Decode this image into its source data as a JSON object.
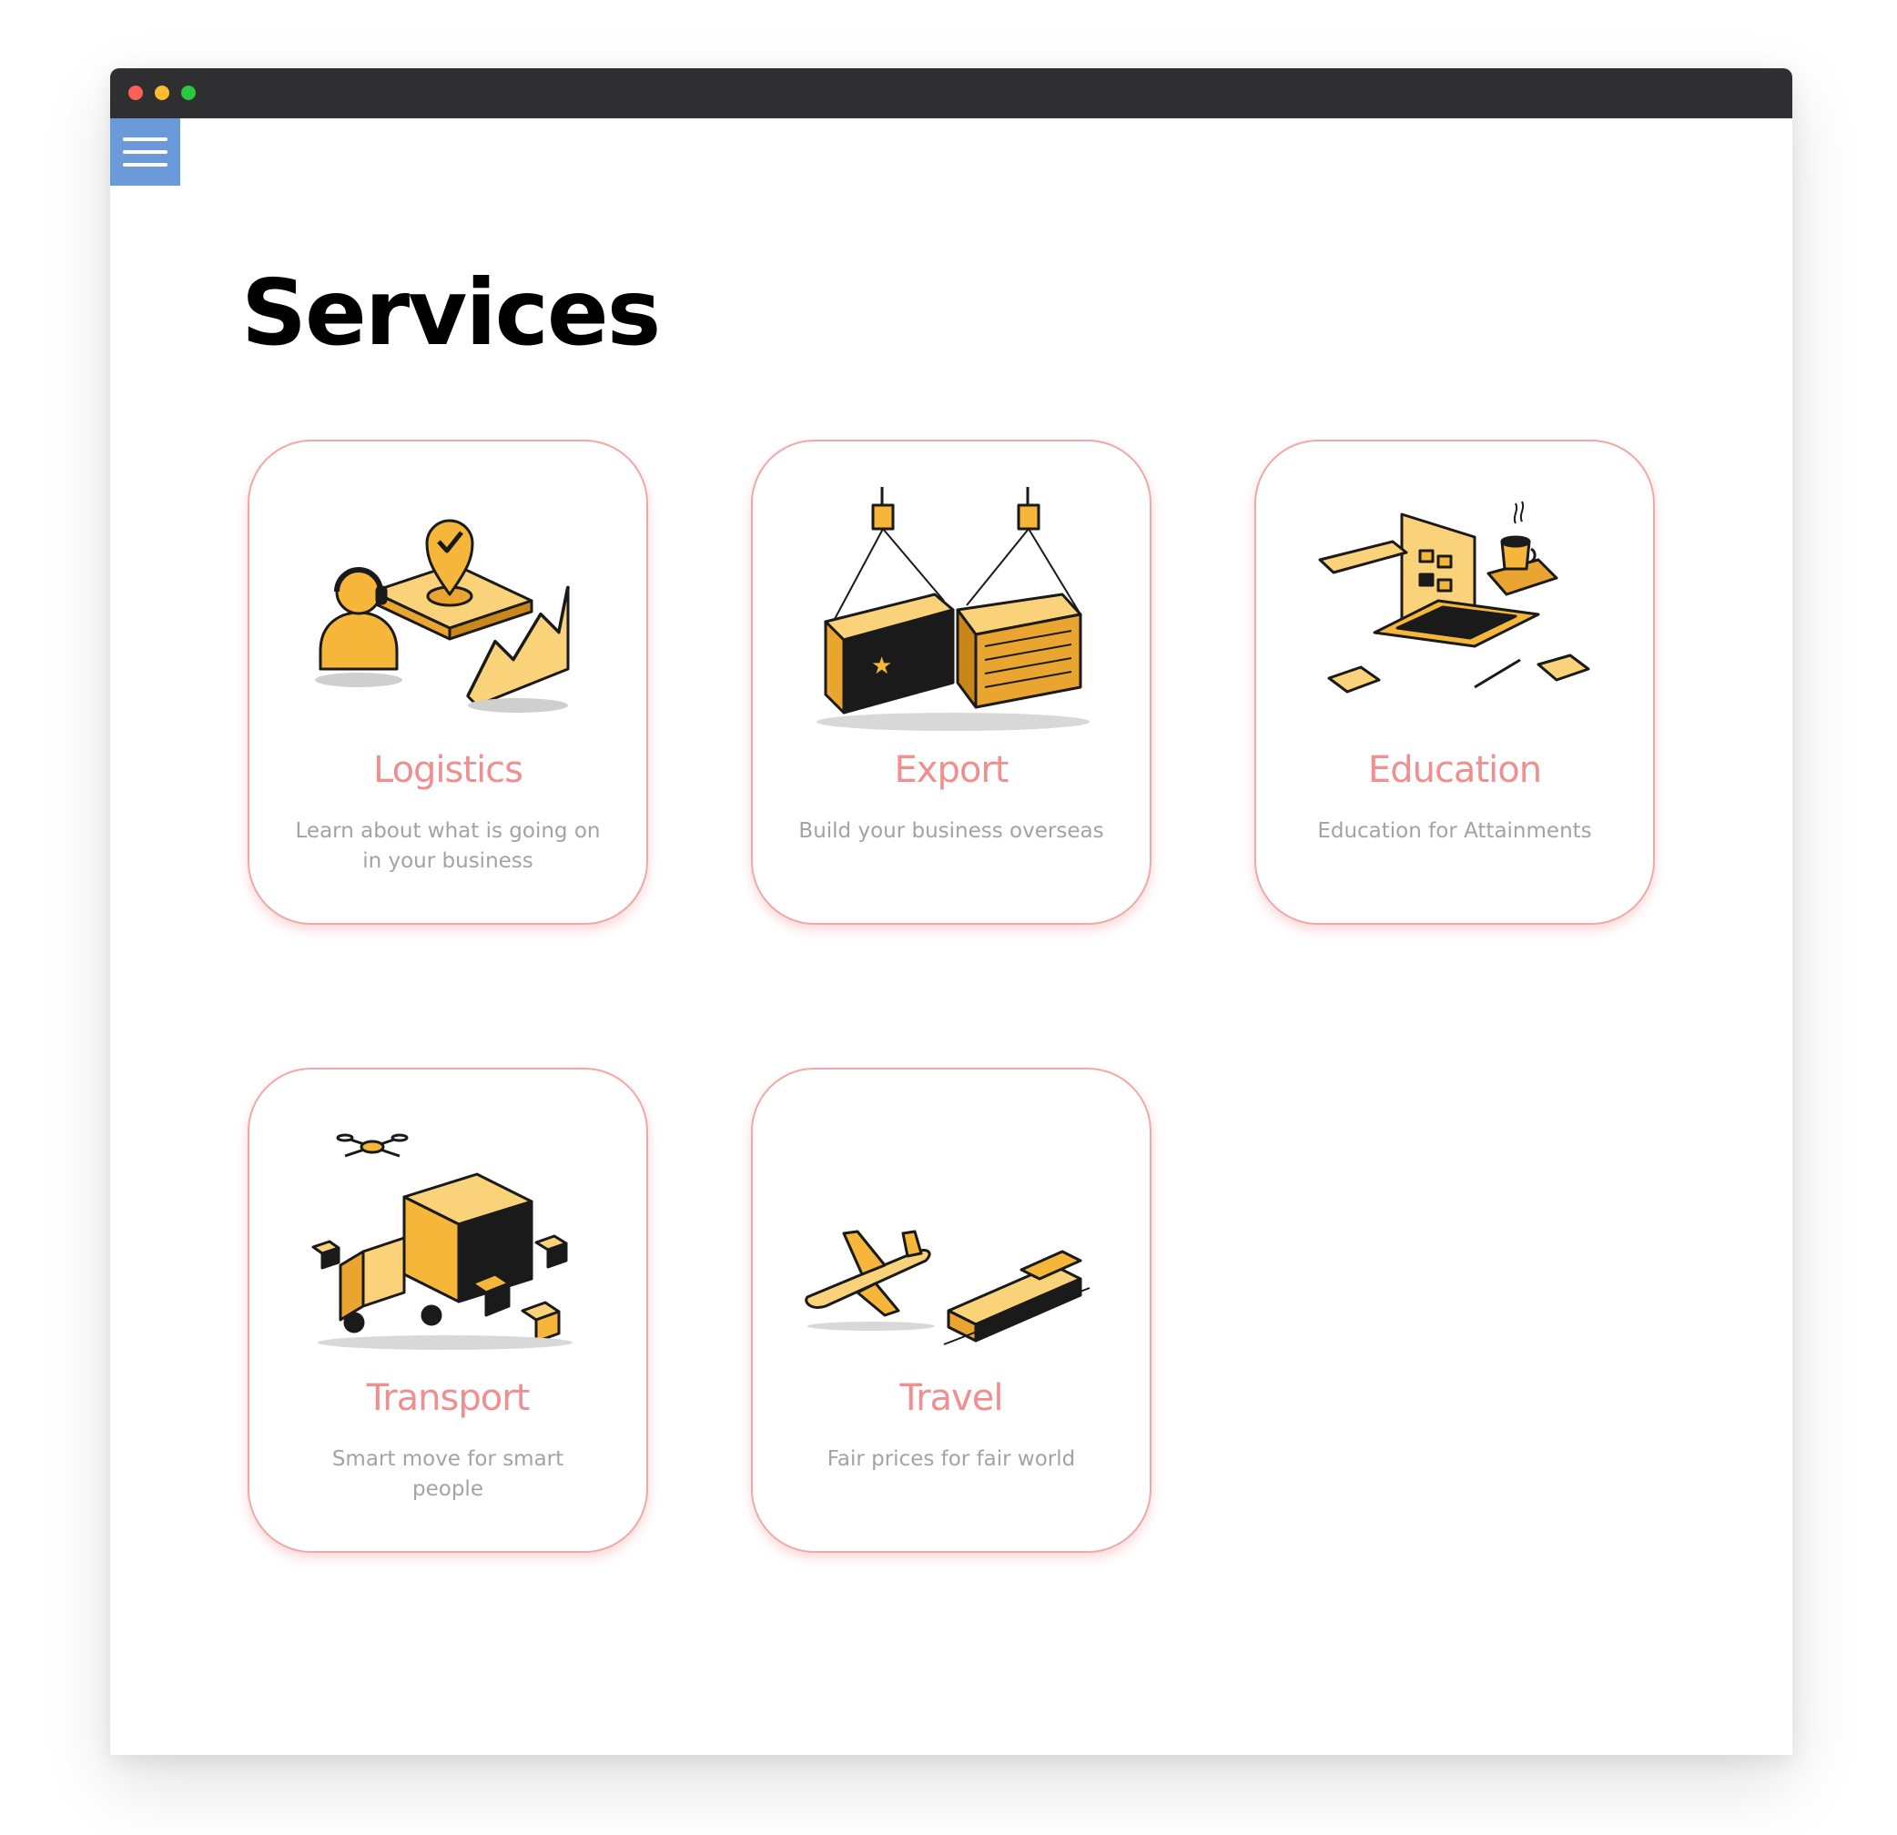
{
  "window": {
    "controls": {
      "close_color": "#ff5f57",
      "minimize_color": "#febc2e",
      "maximize_color": "#28c840"
    }
  },
  "menu": {
    "icon": "hamburger-icon",
    "color": "#6a9bd8"
  },
  "page": {
    "title": "Services"
  },
  "accent_color": "#f08f8f",
  "cards": [
    {
      "title": "Logistics",
      "description": "Learn about what is going on in your business",
      "icon": "logistics-illustration"
    },
    {
      "title": "Export",
      "description": "Build your business overseas",
      "icon": "export-containers-illustration"
    },
    {
      "title": "Education",
      "description": "Education for Attainments",
      "icon": "education-laptop-illustration"
    },
    {
      "title": "Transport",
      "description": "Smart move for smart people",
      "icon": "transport-truck-illustration"
    },
    {
      "title": "Travel",
      "description": "Fair prices for fair world",
      "icon": "travel-plane-train-illustration"
    }
  ]
}
